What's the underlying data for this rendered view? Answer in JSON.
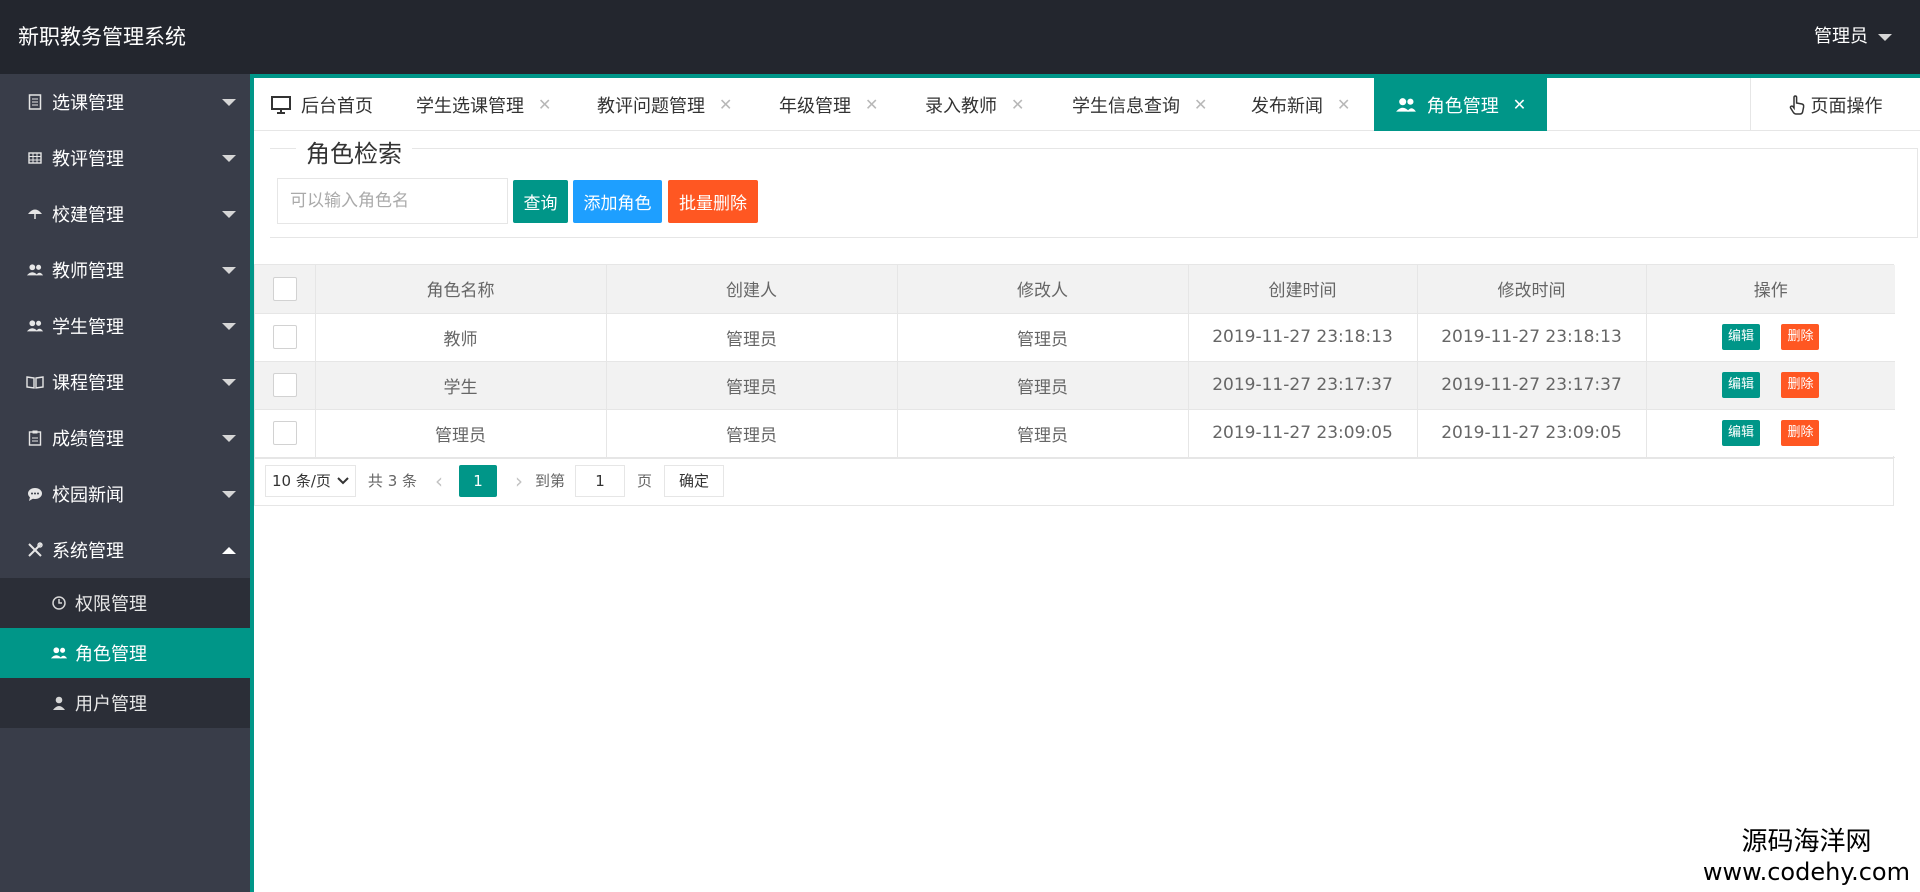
{
  "header": {
    "brand": "新职教务管理系统",
    "user": "管理员"
  },
  "sidebar": {
    "items": [
      {
        "label": "选课管理",
        "icon": "document-icon"
      },
      {
        "label": "教评管理",
        "icon": "grid-icon"
      },
      {
        "label": "校建管理",
        "icon": "umbrella-icon"
      },
      {
        "label": "教师管理",
        "icon": "users-icon"
      },
      {
        "label": "学生管理",
        "icon": "users-icon"
      },
      {
        "label": "课程管理",
        "icon": "book-icon"
      },
      {
        "label": "成绩管理",
        "icon": "clipboard-icon"
      },
      {
        "label": "校园新闻",
        "icon": "chat-icon"
      },
      {
        "label": "系统管理",
        "icon": "tools-icon"
      }
    ],
    "subitems": [
      {
        "label": "权限管理",
        "icon": "key-icon"
      },
      {
        "label": "角色管理",
        "icon": "users-icon"
      },
      {
        "label": "用户管理",
        "icon": "user-icon"
      }
    ]
  },
  "tabs": {
    "items": [
      "后台首页",
      "学生选课管理",
      "教评问题管理",
      "年级管理",
      "录入教师",
      "学生信息查询",
      "发布新闻",
      "角色管理"
    ],
    "close": "✕",
    "page_ops": "页面操作"
  },
  "search": {
    "legend": "角色检索",
    "placeholder": "可以输入角色名",
    "query": "查询",
    "add": "添加角色",
    "batch_delete": "批量删除"
  },
  "table": {
    "headers": [
      "角色名称",
      "创建人",
      "修改人",
      "创建时间",
      "修改时间",
      "操作"
    ],
    "rows": [
      {
        "name": "教师",
        "creator": "管理员",
        "modifier": "管理员",
        "created": "2019-11-27 23:18:13",
        "modified": "2019-11-27 23:18:13"
      },
      {
        "name": "学生",
        "creator": "管理员",
        "modifier": "管理员",
        "created": "2019-11-27 23:17:37",
        "modified": "2019-11-27 23:17:37"
      },
      {
        "name": "管理员",
        "creator": "管理员",
        "modifier": "管理员",
        "created": "2019-11-27 23:09:05",
        "modified": "2019-11-27 23:09:05"
      }
    ],
    "edit": "编辑",
    "delete": "删除"
  },
  "pager": {
    "per_page": "10 条/页",
    "total": "共 3 条",
    "current": "1",
    "goto_prefix": "到第",
    "goto_value": "1",
    "goto_suffix": "页",
    "confirm": "确定"
  },
  "watermark": {
    "line1": "源码海洋网",
    "line2": "www.codehy.com"
  },
  "colors": {
    "primary": "#009688",
    "blue": "#1e9fff",
    "orange": "#ff5722",
    "header_bg": "#23262e",
    "sidebar_bg": "#393d49"
  }
}
